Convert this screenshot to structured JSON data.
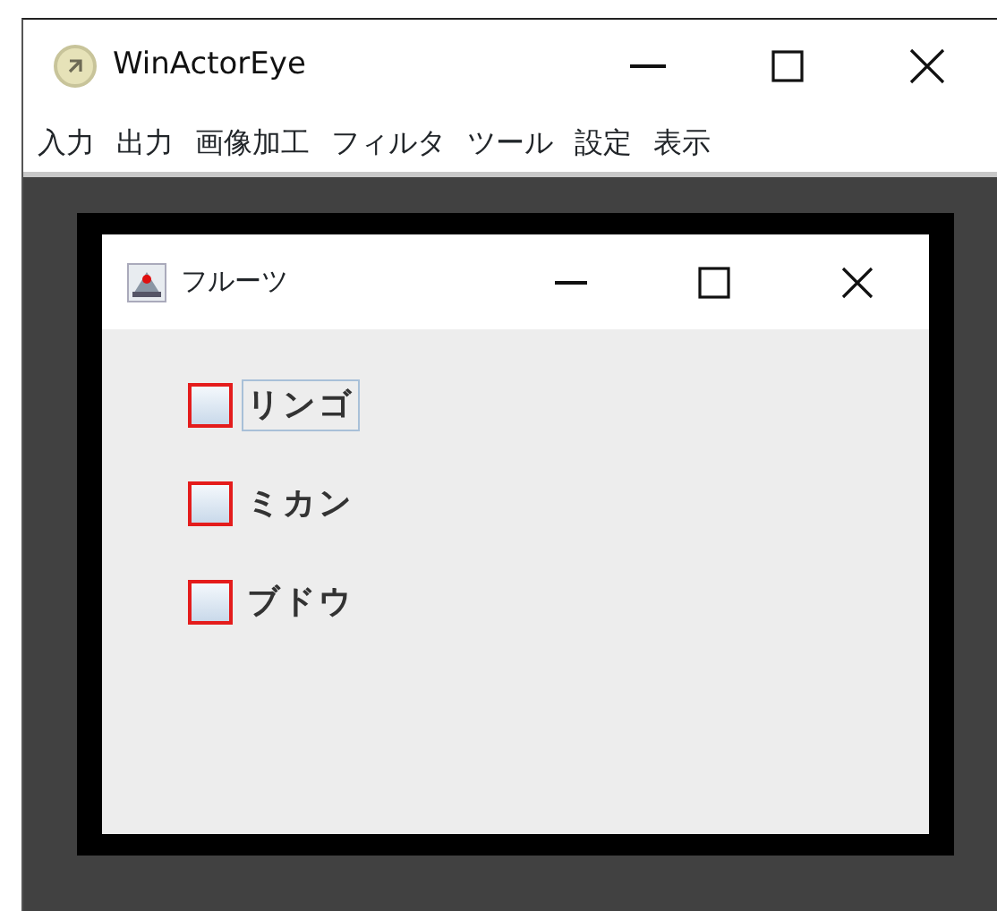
{
  "window": {
    "title": "WinActorEye"
  },
  "menu": [
    "入力",
    "出力",
    "画像加工",
    "フィルタ",
    "ツール",
    "設定",
    "表示"
  ],
  "dialog": {
    "title": "フルーツ",
    "checkboxes": [
      {
        "label": "リンゴ",
        "checked": false,
        "highlighted": true,
        "focused": true
      },
      {
        "label": "ミカン",
        "checked": false,
        "highlighted": true,
        "focused": false
      },
      {
        "label": "ブドウ",
        "checked": false,
        "highlighted": true,
        "focused": false
      }
    ]
  }
}
